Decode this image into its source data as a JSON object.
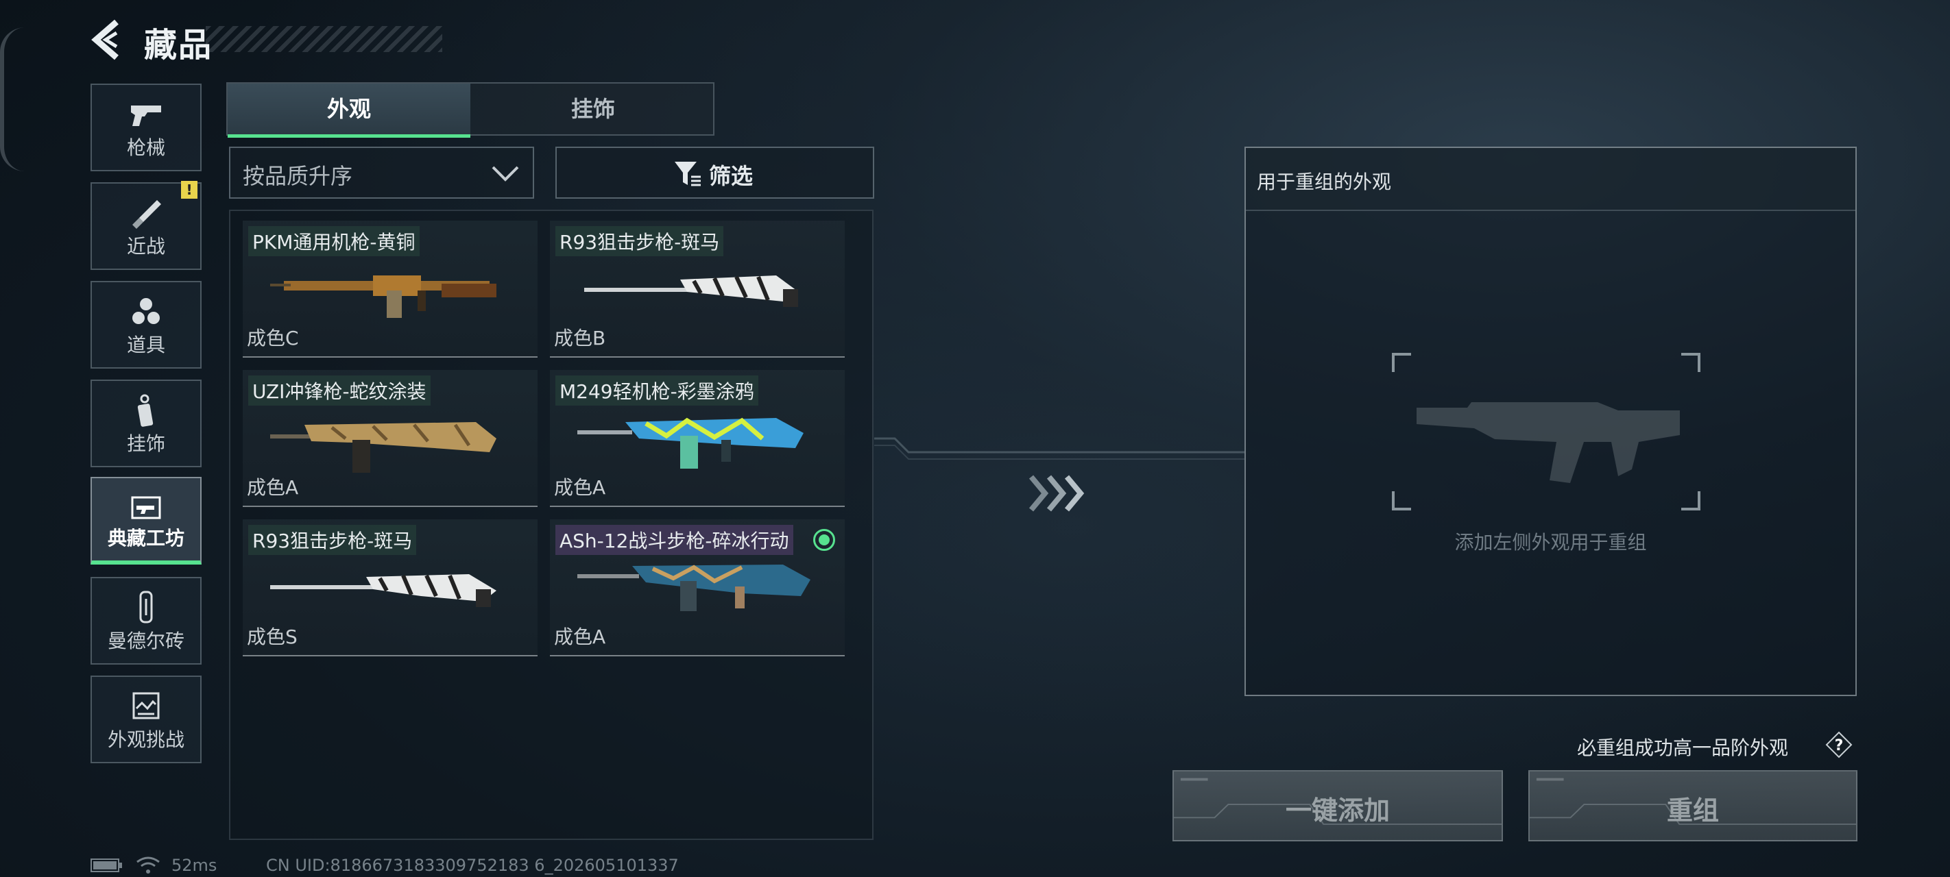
{
  "header": {
    "title": "藏品",
    "back_icon": "back-arrow-icon"
  },
  "sidebar": {
    "items": [
      {
        "label": "枪械",
        "icon": "pistol-icon",
        "active": false,
        "badge": ""
      },
      {
        "label": "近战",
        "icon": "knife-icon",
        "active": false,
        "badge": "!"
      },
      {
        "label": "道具",
        "icon": "grenade-icon",
        "active": false,
        "badge": ""
      },
      {
        "label": "挂饰",
        "icon": "charm-icon",
        "active": false,
        "badge": ""
      },
      {
        "label": "典藏工坊",
        "icon": "workshop-icon",
        "active": true,
        "badge": ""
      },
      {
        "label": "曼德尔砖",
        "icon": "brick-icon",
        "active": false,
        "badge": ""
      },
      {
        "label": "外观挑战",
        "icon": "challenge-icon",
        "active": false,
        "badge": ""
      }
    ]
  },
  "tabs": [
    {
      "label": "外观",
      "active": true
    },
    {
      "label": "挂饰",
      "active": false
    }
  ],
  "sort": {
    "value": "按品质升序"
  },
  "filter": {
    "label": "筛选"
  },
  "items": [
    {
      "name": "PKM通用机枪-黄铜",
      "condition": "成色C",
      "selected": false
    },
    {
      "name": "R93狙击步枪-斑马",
      "condition": "成色B",
      "selected": false
    },
    {
      "name": "UZI冲锋枪-蛇纹涂装",
      "condition": "成色A",
      "selected": false
    },
    {
      "name": "M249轻机枪-彩墨涂鸦",
      "condition": "成色A",
      "selected": false
    },
    {
      "name": "R93狙击步枪-斑马",
      "condition": "成色S",
      "selected": false
    },
    {
      "name": "ASh-12战斗步枪-碎冰行动",
      "condition": "成色A",
      "selected": true
    }
  ],
  "recombine": {
    "panel_title": "用于重组的外观",
    "hint": "添加左侧外观用于重组",
    "guarantee": "必重组成功高一品阶外观",
    "add_all_label": "一键添加",
    "recombine_label": "重组"
  },
  "status": {
    "ping": "52ms",
    "uid": "CN UID:8186673183309752183 6_202605101337"
  },
  "colors": {
    "accent": "#57e28f",
    "badge": "#e8d44c"
  }
}
